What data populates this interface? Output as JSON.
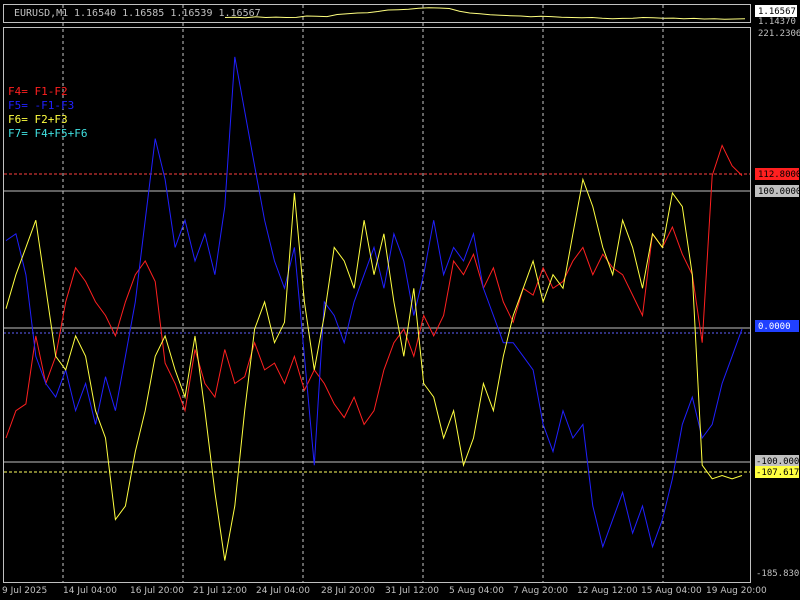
{
  "main_window": {
    "symbol_label": "EURUSD,M1",
    "ohlc_text": "1.16540 1.16585 1.16539 1.16567",
    "price_current": "1.16567",
    "price_low": "1.14370",
    "price_line": [
      0.3,
      0.32,
      0.28,
      0.35,
      0.3,
      0.33,
      0.3,
      0.31,
      0.4,
      0.38,
      0.36,
      0.5,
      0.55,
      0.6,
      0.62,
      0.7,
      0.8,
      0.82,
      0.85,
      0.92,
      0.95,
      0.93,
      0.9,
      0.72,
      0.6,
      0.55,
      0.48,
      0.45,
      0.42,
      0.4,
      0.35,
      0.38,
      0.36,
      0.32,
      0.3,
      0.28,
      0.3,
      0.25,
      0.22,
      0.24,
      0.25,
      0.3,
      0.28,
      0.25,
      0.26,
      0.22,
      0.24,
      0.2,
      0.22,
      0.18,
      0.2,
      0.22
    ]
  },
  "indicator": {
    "scale_max": "221.2306",
    "scale_min": "-185.8306",
    "legend": [
      {
        "text": "F4= F1-F2",
        "color": "#ff2020"
      },
      {
        "text": "F5= -F1-F3",
        "color": "#2020ff"
      },
      {
        "text": "F6= F2+F3",
        "color": "#ffff40"
      },
      {
        "text": "F7= F4+F5+F6",
        "color": "#40e0e0"
      }
    ],
    "labels": {
      "level_plus_100": "100.0000",
      "level_minus_100": "-100.0000",
      "level_zero": "0.0000",
      "red_value": "112.8000",
      "yellow_value": "-107.6172"
    },
    "colors": {
      "red": "#ff2020",
      "blue": "#2020ff",
      "yellow": "#ffff40",
      "level_line": "#c0c0c0",
      "grid": "#c8c8c8"
    }
  },
  "time_axis": [
    "9 Jul 2025",
    "14 Jul 04:00",
    "16 Jul 20:00",
    "21 Jul 12:00",
    "24 Jul 04:00",
    "28 Jul 20:00",
    "31 Jul 12:00",
    "5 Aug 04:00",
    "7 Aug 20:00",
    "12 Aug 12:00",
    "15 Aug 04:00",
    "19 Aug 20:00"
  ],
  "chart_data": {
    "type": "line",
    "ylim": [
      -185.8306,
      221.2306
    ],
    "levels": [
      100,
      0,
      -100
    ],
    "series": [
      {
        "name": "F4= F1-F2",
        "color": "#ff2020",
        "x": [
          0,
          10,
          20,
          30,
          40,
          50,
          60,
          70,
          80,
          90,
          100,
          110,
          120,
          130,
          140,
          150,
          160,
          170,
          180,
          190,
          200,
          210,
          220,
          230,
          240,
          250,
          260,
          270,
          280,
          290,
          300,
          310,
          320,
          330,
          340,
          350,
          360,
          370,
          380,
          390,
          400,
          410,
          420,
          430,
          440,
          450,
          460,
          470,
          480,
          490,
          500,
          510,
          520,
          530,
          540,
          550,
          560,
          570,
          580,
          590,
          600,
          610,
          620,
          630,
          640,
          650,
          660,
          670,
          680,
          690,
          700,
          710,
          720,
          730,
          740
        ],
        "y": [
          -80,
          -60,
          -55,
          -5,
          -40,
          -20,
          20,
          45,
          35,
          20,
          10,
          -5,
          20,
          40,
          50,
          35,
          -25,
          -40,
          -60,
          -15,
          -40,
          -50,
          -15,
          -40,
          -35,
          -10,
          -30,
          -25,
          -40,
          -20,
          -45,
          -30,
          -40,
          -55,
          -65,
          -50,
          -70,
          -60,
          -30,
          -10,
          0,
          -20,
          10,
          -5,
          10,
          50,
          40,
          55,
          30,
          45,
          20,
          5,
          30,
          25,
          45,
          30,
          35,
          50,
          60,
          40,
          55,
          45,
          40,
          25,
          10,
          70,
          60,
          75,
          55,
          40,
          -10,
          112.8,
          135,
          120,
          112.8
        ]
      },
      {
        "name": "F5= -F1-F3",
        "color": "#2020ff",
        "x": [
          0,
          10,
          20,
          30,
          40,
          50,
          60,
          70,
          80,
          90,
          100,
          110,
          120,
          130,
          140,
          150,
          160,
          170,
          180,
          190,
          200,
          210,
          220,
          230,
          240,
          250,
          260,
          270,
          280,
          290,
          300,
          310,
          320,
          330,
          340,
          350,
          360,
          370,
          380,
          390,
          400,
          410,
          420,
          430,
          440,
          450,
          460,
          470,
          480,
          490,
          500,
          510,
          520,
          530,
          540,
          550,
          560,
          570,
          580,
          590,
          600,
          610,
          620,
          630,
          640,
          650,
          660,
          670,
          680,
          690,
          700,
          710,
          720,
          730,
          740
        ],
        "y": [
          65,
          70,
          40,
          -20,
          -40,
          -50,
          -30,
          -60,
          -40,
          -70,
          -35,
          -60,
          -20,
          20,
          80,
          140,
          110,
          60,
          80,
          50,
          70,
          40,
          90,
          200,
          160,
          120,
          80,
          50,
          30,
          60,
          -20,
          -100,
          20,
          10,
          -10,
          20,
          40,
          60,
          30,
          70,
          50,
          10,
          40,
          80,
          40,
          60,
          50,
          70,
          30,
          10,
          -10,
          -10,
          -20,
          -30,
          -70,
          -90,
          -60,
          -80,
          -70,
          -130,
          -160,
          -140,
          -120,
          -150,
          -130,
          -160,
          -140,
          -110,
          -70,
          -50,
          -80,
          -70,
          -40,
          -20,
          0
        ]
      },
      {
        "name": "F6= F2+F3",
        "color": "#ffff40",
        "x": [
          0,
          10,
          20,
          30,
          40,
          50,
          60,
          70,
          80,
          90,
          100,
          110,
          120,
          130,
          140,
          150,
          160,
          170,
          180,
          190,
          200,
          210,
          220,
          230,
          240,
          250,
          260,
          270,
          280,
          290,
          300,
          310,
          320,
          330,
          340,
          350,
          360,
          370,
          380,
          390,
          400,
          410,
          420,
          430,
          440,
          450,
          460,
          470,
          480,
          490,
          500,
          510,
          520,
          530,
          540,
          550,
          560,
          570,
          580,
          590,
          600,
          610,
          620,
          630,
          640,
          650,
          660,
          670,
          680,
          690,
          700,
          710,
          720,
          730,
          740
        ],
        "y": [
          15,
          40,
          60,
          80,
          30,
          -20,
          -30,
          -5,
          -20,
          -60,
          -80,
          -140,
          -130,
          -90,
          -60,
          -20,
          -5,
          -30,
          -50,
          -5,
          -60,
          -120,
          -170,
          -130,
          -60,
          0,
          20,
          -10,
          5,
          100,
          20,
          -30,
          10,
          60,
          50,
          30,
          80,
          40,
          70,
          20,
          -20,
          30,
          -40,
          -50,
          -80,
          -60,
          -100,
          -80,
          -40,
          -60,
          -20,
          10,
          30,
          50,
          20,
          40,
          30,
          70,
          110,
          90,
          60,
          40,
          80,
          60,
          30,
          70,
          60,
          100,
          90,
          40,
          -100,
          -110,
          -107.6,
          -110,
          -107.6
        ]
      }
    ]
  }
}
